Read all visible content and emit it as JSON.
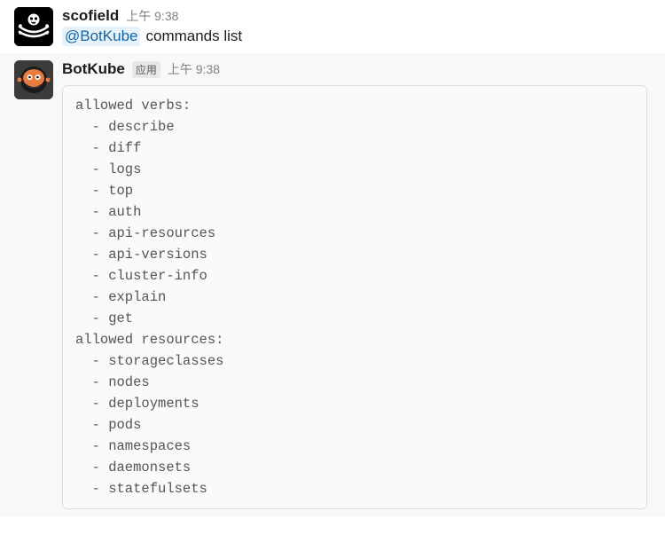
{
  "messages": [
    {
      "author": "scofield",
      "timestamp": "上午 9:38",
      "mention": "@BotKube",
      "text": " commands list"
    },
    {
      "author": "BotKube",
      "app_badge": "应用",
      "timestamp": "上午 9:38",
      "code_headers": {
        "verbs": "allowed verbs:",
        "resources": "allowed resources:"
      },
      "allowed_verbs": [
        "describe",
        "diff",
        "logs",
        "top",
        "auth",
        "api-resources",
        "api-versions",
        "cluster-info",
        "explain",
        "get"
      ],
      "allowed_resources": [
        "storageclasses",
        "nodes",
        "deployments",
        "pods",
        "namespaces",
        "daemonsets",
        "statefulsets"
      ]
    }
  ]
}
